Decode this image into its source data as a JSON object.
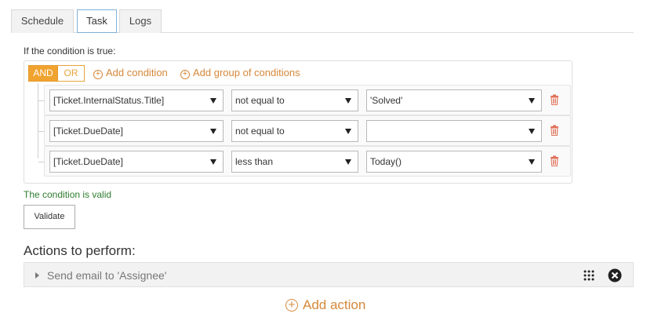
{
  "tabs": [
    {
      "label": "Schedule",
      "active": false
    },
    {
      "label": "Task",
      "active": true
    },
    {
      "label": "Logs",
      "active": false
    }
  ],
  "condition": {
    "heading": "If the condition is true:",
    "and_label": "AND",
    "or_label": "OR",
    "add_condition_label": "Add condition",
    "add_group_label": "Add group of conditions",
    "rows": [
      {
        "field": "[Ticket.InternalStatus.Title]",
        "operator": "not equal to",
        "value": "'Solved'"
      },
      {
        "field": "[Ticket.DueDate]",
        "operator": "not equal to",
        "value": ""
      },
      {
        "field": "[Ticket.DueDate]",
        "operator": "less than",
        "value": "Today()"
      }
    ],
    "status": "The condition is valid",
    "validate_label": "Validate"
  },
  "actions": {
    "heading": "Actions to perform:",
    "items": [
      {
        "label": "Send email to 'Assignee'"
      }
    ],
    "add_label": "Add action"
  },
  "colors": {
    "accent": "#f0a32f",
    "link": "#d5883a",
    "valid": "#2e7d2e",
    "tab_active_border": "#7fb0d8"
  },
  "icons": [
    "plus-circle-icon",
    "chevron-down-icon",
    "trash-icon",
    "caret-right-icon",
    "drag-grip-icon",
    "close-icon"
  ]
}
